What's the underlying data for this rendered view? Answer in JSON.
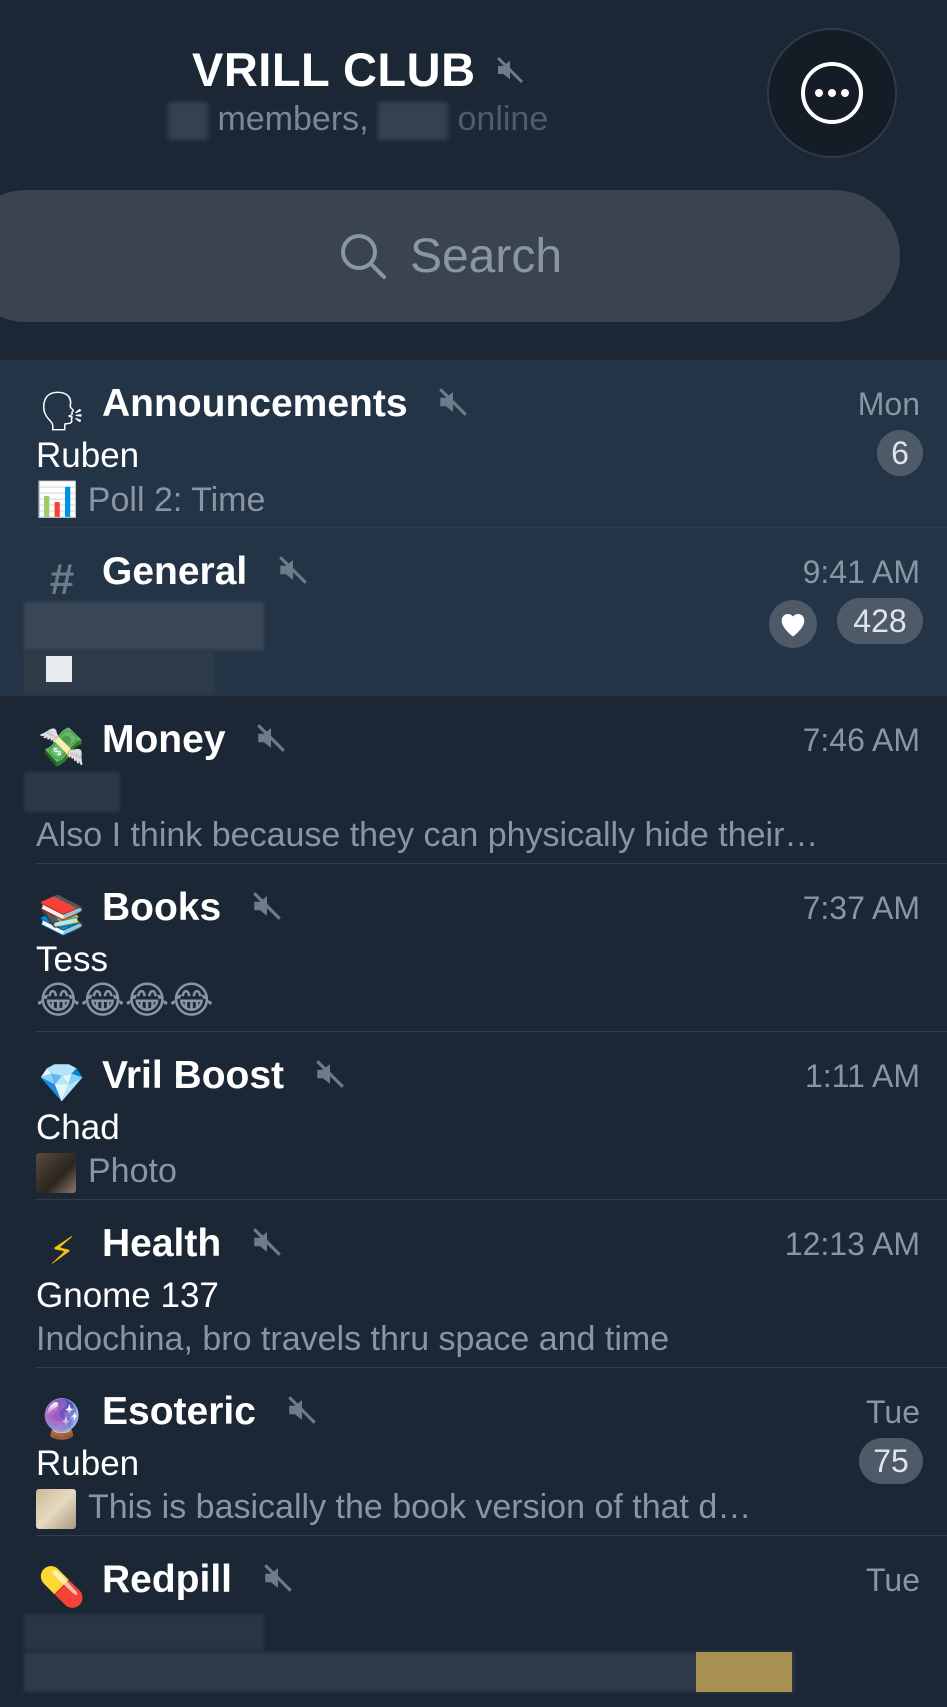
{
  "header": {
    "title": "VRILL CLUB",
    "subtitle_members": "members,",
    "subtitle_online": "online"
  },
  "search": {
    "placeholder": "Search"
  },
  "topics": [
    {
      "name": "Announcements",
      "icon": "speaking-head-emoji",
      "icon_glyph": "🗣",
      "time": "Mon",
      "sender": "Ruben",
      "message": "Poll 2: Time",
      "message_prefix_glyph": "📊",
      "unread": "6",
      "highlighted": true
    },
    {
      "name": "General",
      "icon": "hashtag-icon",
      "icon_glyph": "#",
      "time": "9:41 AM",
      "unread": "428",
      "reaction": "heart",
      "highlighted": true
    },
    {
      "name": "Money",
      "icon": "money-with-wings-emoji",
      "icon_glyph": "💸",
      "time": "7:46 AM",
      "message": "Also I think because they can physically hide their…"
    },
    {
      "name": "Books",
      "icon": "books-emoji",
      "icon_glyph": "📚",
      "time": "7:37 AM",
      "sender": "Tess",
      "message": "😂😂😂😂"
    },
    {
      "name": "Vril Boost",
      "icon": "gem-emoji",
      "icon_glyph": "💎",
      "time": "1:11 AM",
      "sender": "Chad",
      "message": "Photo"
    },
    {
      "name": "Health",
      "icon": "lightning-emoji",
      "icon_glyph": "⚡",
      "time": "12:13 AM",
      "sender": "Gnome 137",
      "message": "Indochina, bro travels thru space and time"
    },
    {
      "name": "Esoteric",
      "icon": "crystal-ball-emoji",
      "icon_glyph": "🔮",
      "time": "Tue",
      "sender": "Ruben",
      "message": "This is basically the book version of that d…",
      "unread": "75"
    },
    {
      "name": "Redpill",
      "icon": "pill-emoji",
      "icon_glyph": "💊",
      "time": "Tue"
    }
  ],
  "colors": {
    "background": "#1c2735",
    "highlight": "#243447",
    "badge": "#4e5a68",
    "muted_text": "#8995a3"
  }
}
